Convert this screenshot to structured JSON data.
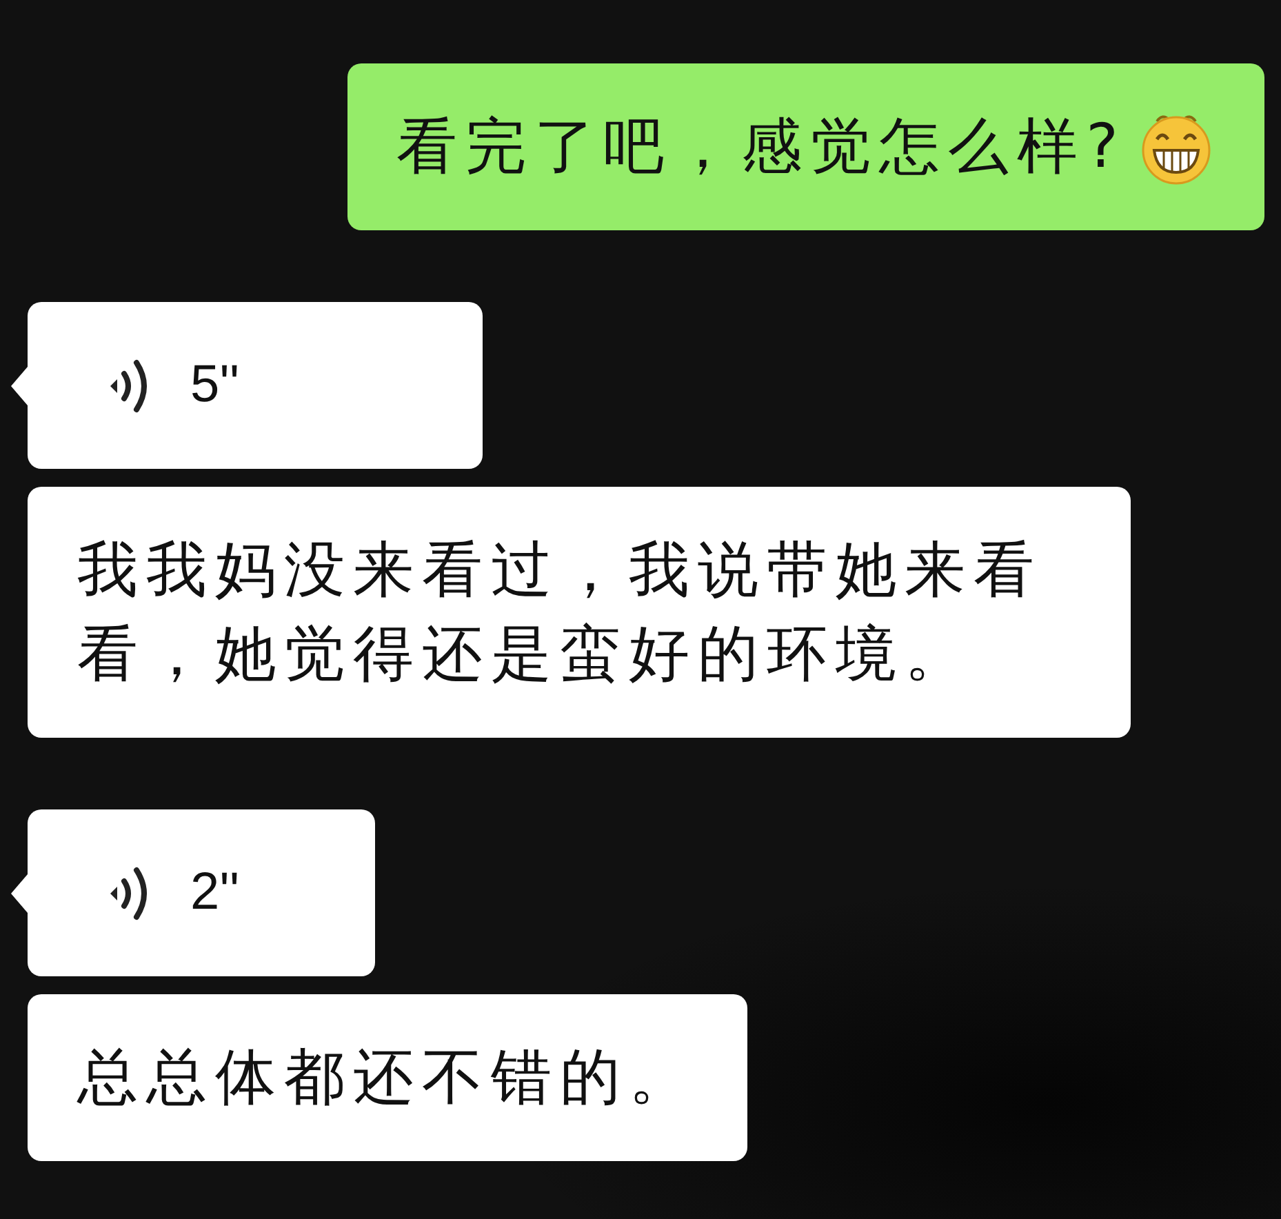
{
  "groups": [
    {
      "outgoing": true,
      "messages": [
        {
          "kind": "text",
          "text": "看完了吧，感觉怎么样?",
          "emoji": true,
          "tail": false
        }
      ]
    },
    {
      "outgoing": false,
      "messages": [
        {
          "kind": "voice",
          "text": "5''",
          "tail": true
        },
        {
          "kind": "text",
          "text": "我我妈没来看过，我说带她来看看，她觉得还是蛮好的环境。",
          "emoji": false,
          "tail": false
        }
      ]
    },
    {
      "outgoing": false,
      "messages": [
        {
          "kind": "voice",
          "text": "2''",
          "tail": true
        },
        {
          "kind": "text",
          "text": "总总体都还不错的。",
          "emoji": false,
          "tail": false
        }
      ]
    }
  ]
}
